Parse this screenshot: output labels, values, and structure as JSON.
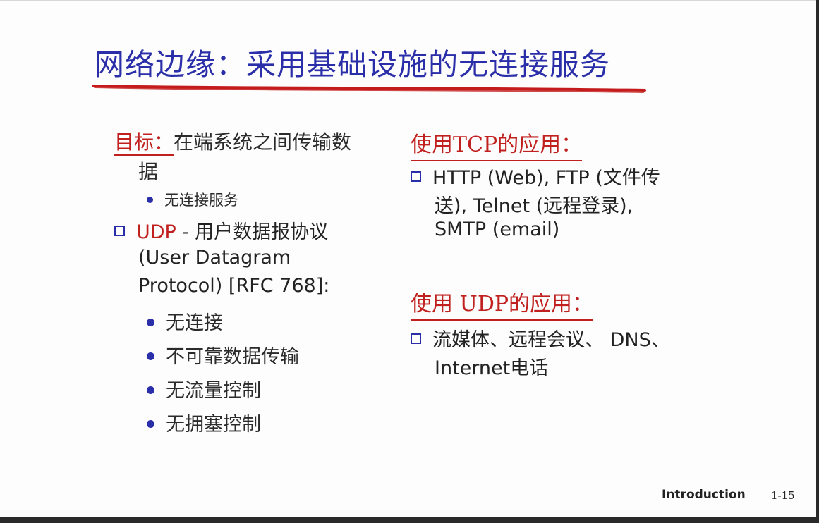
{
  "slide": {
    "title": "网络边缘：采用基础设施的无连接服务",
    "left": {
      "goal_label": "目标：",
      "goal_text": "在端系统之间传输数",
      "goal_text_wrap": "据",
      "goal_sub": "无连接服务",
      "udp_word": "UDP",
      "udp_rest": " - 用户数据报协议",
      "udp_line2": "(User Datagram",
      "udp_line3": "Protocol) [RFC 768]:",
      "udp_bullets": [
        "无连接",
        "不可靠数据传输",
        "无流量控制",
        "无拥塞控制"
      ]
    },
    "right": {
      "tcp_heading": "使用TCP的应用：",
      "tcp_line1": "HTTP (Web), FTP (文件传",
      "tcp_line2": "送), Telnet (远程登录),",
      "tcp_line3": "SMTP (email)",
      "udp_heading": "使用 UDP的应用：",
      "udp_line1": "流媒体、远程会议、 DNS、",
      "udp_line2": "Internet电话"
    },
    "footer": {
      "label": "Introduction",
      "page": "1-15"
    },
    "colors": {
      "title": "#2a2ea8",
      "accent_red": "#c0201e",
      "bullet_blue": "#2a2ea8"
    },
    "icons": {
      "square_bullet": "square-bullet-icon",
      "dot_bullet": "dot-bullet-icon"
    }
  }
}
